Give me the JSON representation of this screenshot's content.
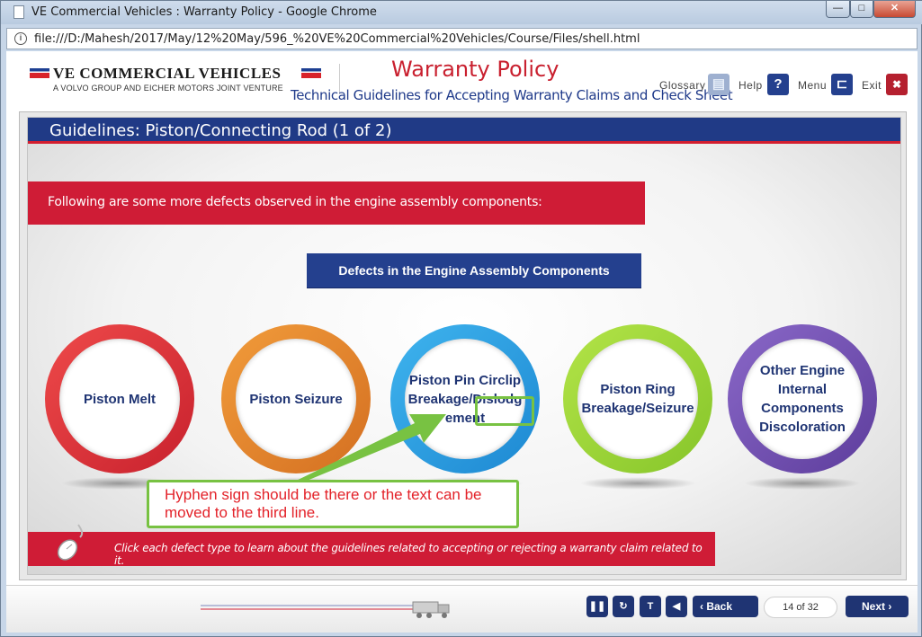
{
  "browser": {
    "window_title": "VE Commercial Vehicles : Warranty Policy - Google Chrome",
    "url": "file:///D:/Mahesh/2017/May/12%20May/596_%20VE%20Commercial%20Vehicles/Course/Files/shell.html",
    "buttons": {
      "minimize": "—",
      "maximize": "□",
      "close": "✕"
    }
  },
  "header": {
    "brand_name": "VE COMMERCIAL VEHICLES",
    "brand_tagline": "A VOLVO GROUP AND EICHER MOTORS JOINT VENTURE",
    "course_title": "Warranty Policy",
    "course_subtitle": "Technical Guidelines for Accepting Warranty Claims and Check Sheet",
    "buttons": {
      "glossary": "Glossary",
      "help": "Help",
      "menu": "Menu",
      "exit": "Exit"
    }
  },
  "slide": {
    "title": "Guidelines: Piston/Connecting Rod (1 of 2)",
    "intro": "Following are some more defects observed in the engine assembly components:",
    "section_heading": "Defects in the Engine Assembly Components",
    "defects": [
      {
        "label": "Piston Melt",
        "color": "#d9303a"
      },
      {
        "label": "Piston Seizure",
        "color": "#e7842b"
      },
      {
        "label": "Piston Pin Circlip Breakage/Dislodg ement",
        "color": "#2e9fe0"
      },
      {
        "label": "Piston Ring Breakage/Seizure",
        "color": "#9dd63a"
      },
      {
        "label": "Other Engine Internal Components Discoloration",
        "color": "#6e4db0"
      }
    ],
    "instruction": "Click each defect type to learn about the guidelines related to accepting or rejecting a warranty claim related to it."
  },
  "annotation": {
    "comment": "Hyphen sign should be there or the text can be moved to the third line.",
    "color": "#78c242",
    "text_color": "#e32229"
  },
  "footer": {
    "back": "Back",
    "next": "Next",
    "page_indicator": "14 of 32",
    "progress_fraction": 0.44
  },
  "colors": {
    "navy": "#1f3473",
    "red": "#cf1c36",
    "title_bar": "#203a86"
  }
}
